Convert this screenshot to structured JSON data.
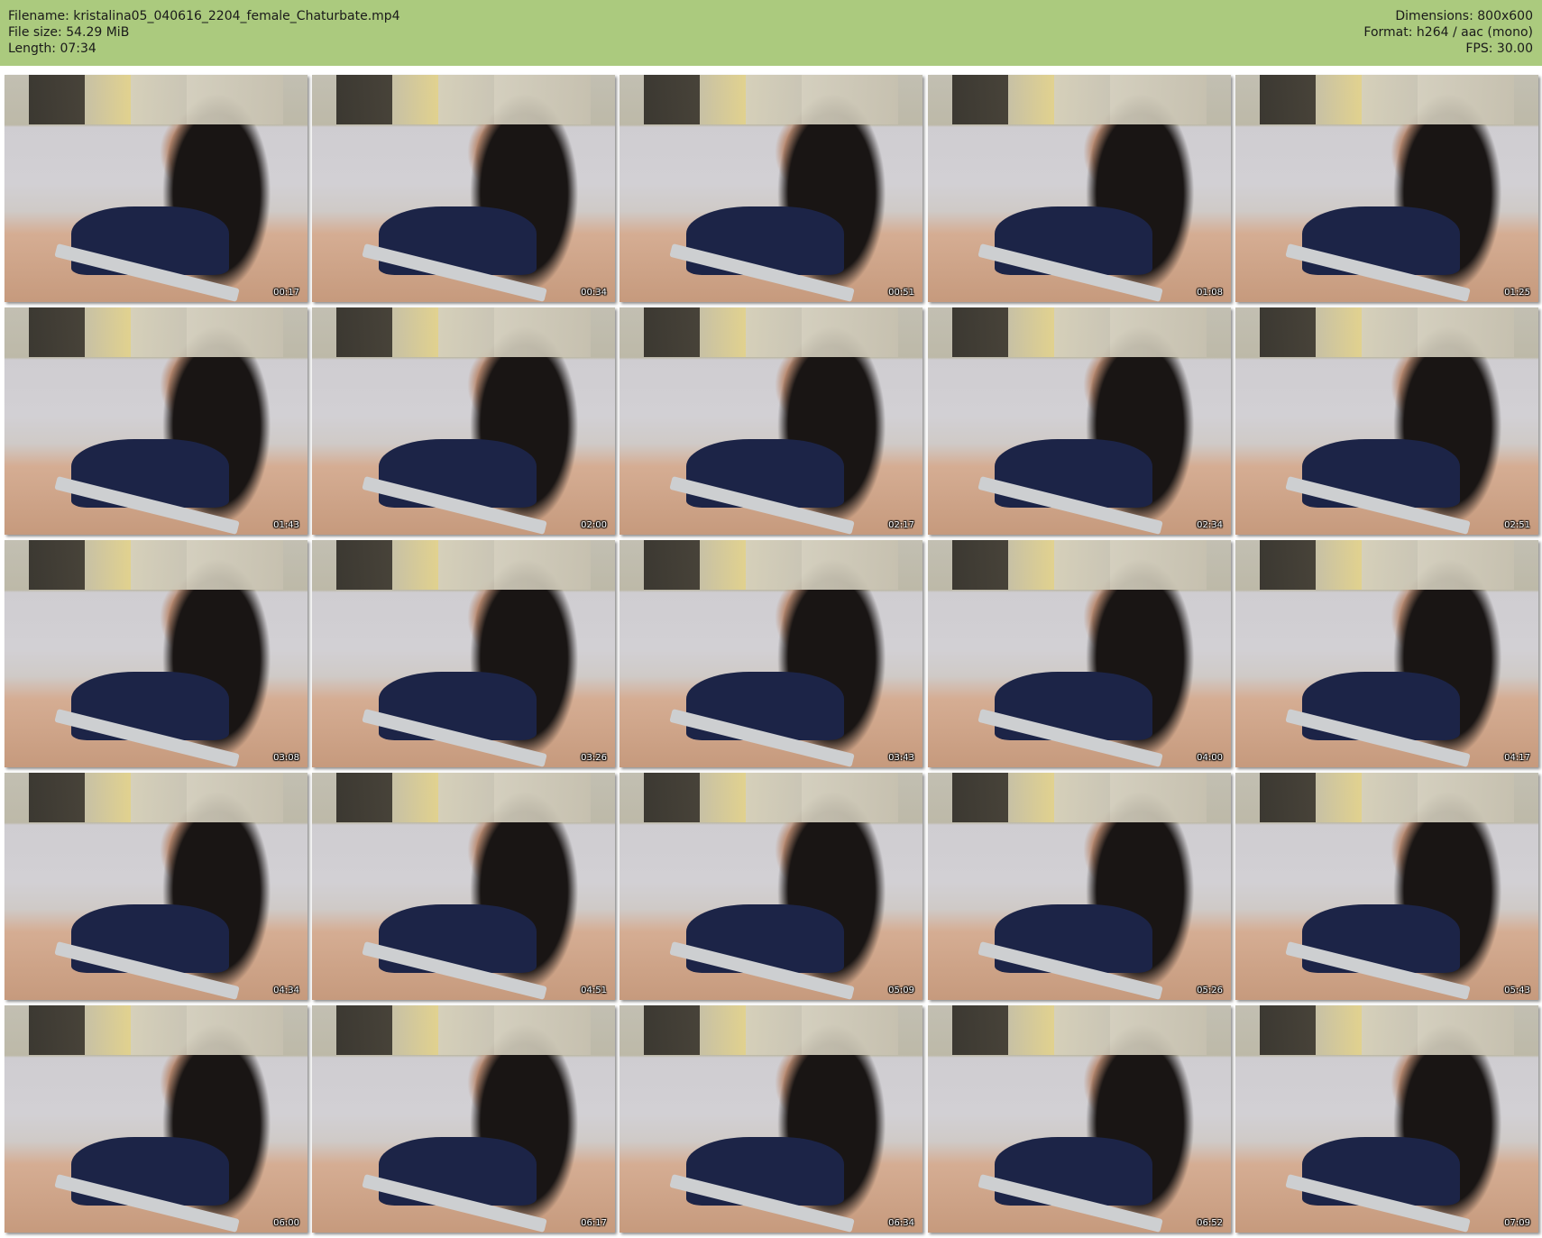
{
  "header": {
    "filename_label": "Filename: kristalina05_040616_2204_female_Chaturbate.mp4",
    "filesize_label": "File size: 54.29 MiB",
    "length_label": "Length: 07:34",
    "dimensions_label": "Dimensions: 800x600",
    "format_label": "Format: h264 / aac (mono)",
    "fps_label": "FPS: 30.00"
  },
  "thumbnails": [
    {
      "time": "00:17"
    },
    {
      "time": "00:34"
    },
    {
      "time": "00:51"
    },
    {
      "time": "01:08"
    },
    {
      "time": "01:25"
    },
    {
      "time": "01:43"
    },
    {
      "time": "02:00"
    },
    {
      "time": "02:17"
    },
    {
      "time": "02:34"
    },
    {
      "time": "02:51"
    },
    {
      "time": "03:08"
    },
    {
      "time": "03:26"
    },
    {
      "time": "03:43"
    },
    {
      "time": "04:00"
    },
    {
      "time": "04:17"
    },
    {
      "time": "04:34"
    },
    {
      "time": "04:51"
    },
    {
      "time": "05:09"
    },
    {
      "time": "05:26"
    },
    {
      "time": "05:43"
    },
    {
      "time": "06:00"
    },
    {
      "time": "06:17"
    },
    {
      "time": "06:34"
    },
    {
      "time": "06:52"
    },
    {
      "time": "07:09"
    }
  ],
  "colors": {
    "header_background": "#abca7e",
    "page_background": "#ffffff"
  }
}
